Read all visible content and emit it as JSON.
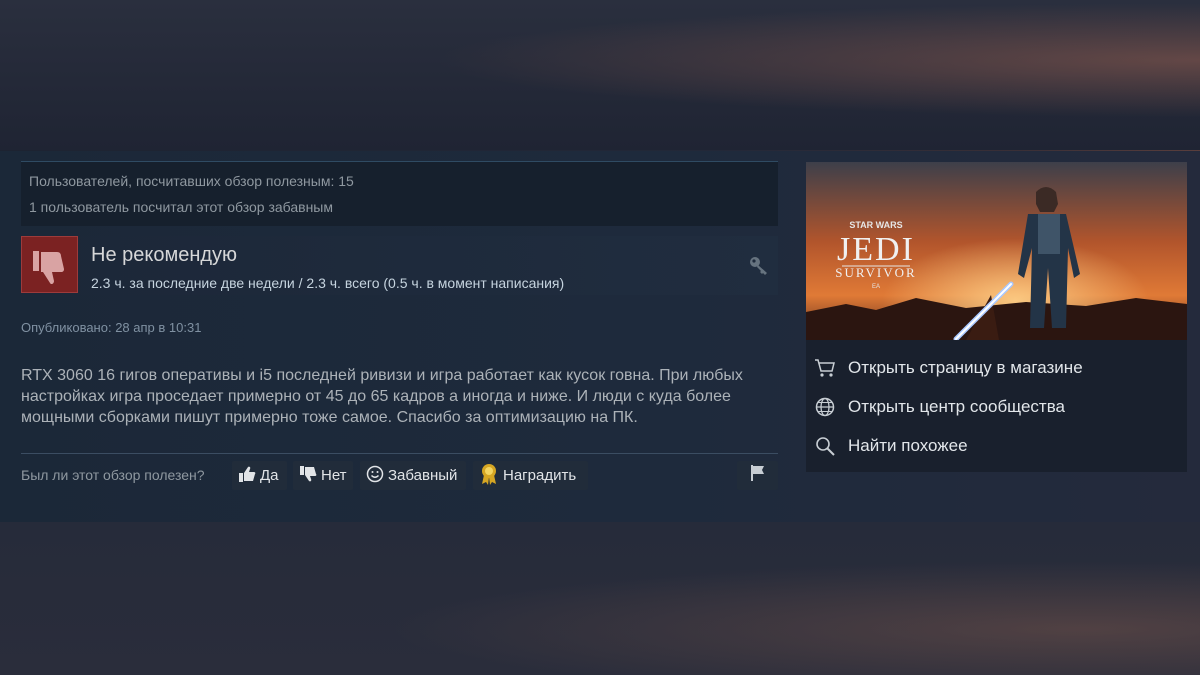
{
  "stats": {
    "helpful": "Пользователей, посчитавших обзор полезным: 15",
    "funny": "1 пользователь посчитал этот обзор забавным"
  },
  "verdict": {
    "title": "Не рекомендую",
    "hours": "2.3 ч. за последние две недели / 2.3 ч. всего (0.5 ч. в момент написания)"
  },
  "posted": "Опубликовано: 28 апр в 10:31",
  "review_text": "RTX 3060 16 гигов оперативы и i5 последней ривизи и игра работает как кусок говна. При любых настройках игра проседает примерно от 45 до 65 кадров а иногда и ниже. И люди с куда более мощными сборками пишут примерно тоже самое. Спасибо за оптимизацию на ПК.",
  "vote": {
    "question": "Был ли этот обзор полезен?",
    "yes": "Да",
    "no": "Нет",
    "funny": "Забавный",
    "award": "Наградить"
  },
  "game": {
    "logo_top": "STAR WARS",
    "logo_main": "JEDI",
    "logo_sub": "SURVIVOR",
    "logo_ea": "EA",
    "links": {
      "store": "Открыть страницу в магазине",
      "hub": "Открыть центр сообщества",
      "similar": "Найти похожее"
    }
  },
  "colors": {
    "thumb_bg": "#7b2222",
    "award_gold": "#d6a623"
  },
  "icons": [
    "thumbs-down-icon",
    "key-icon",
    "thumbs-up-icon",
    "smiley-icon",
    "award-icon",
    "flag-icon",
    "cart-icon",
    "globe-icon",
    "search-icon"
  ]
}
